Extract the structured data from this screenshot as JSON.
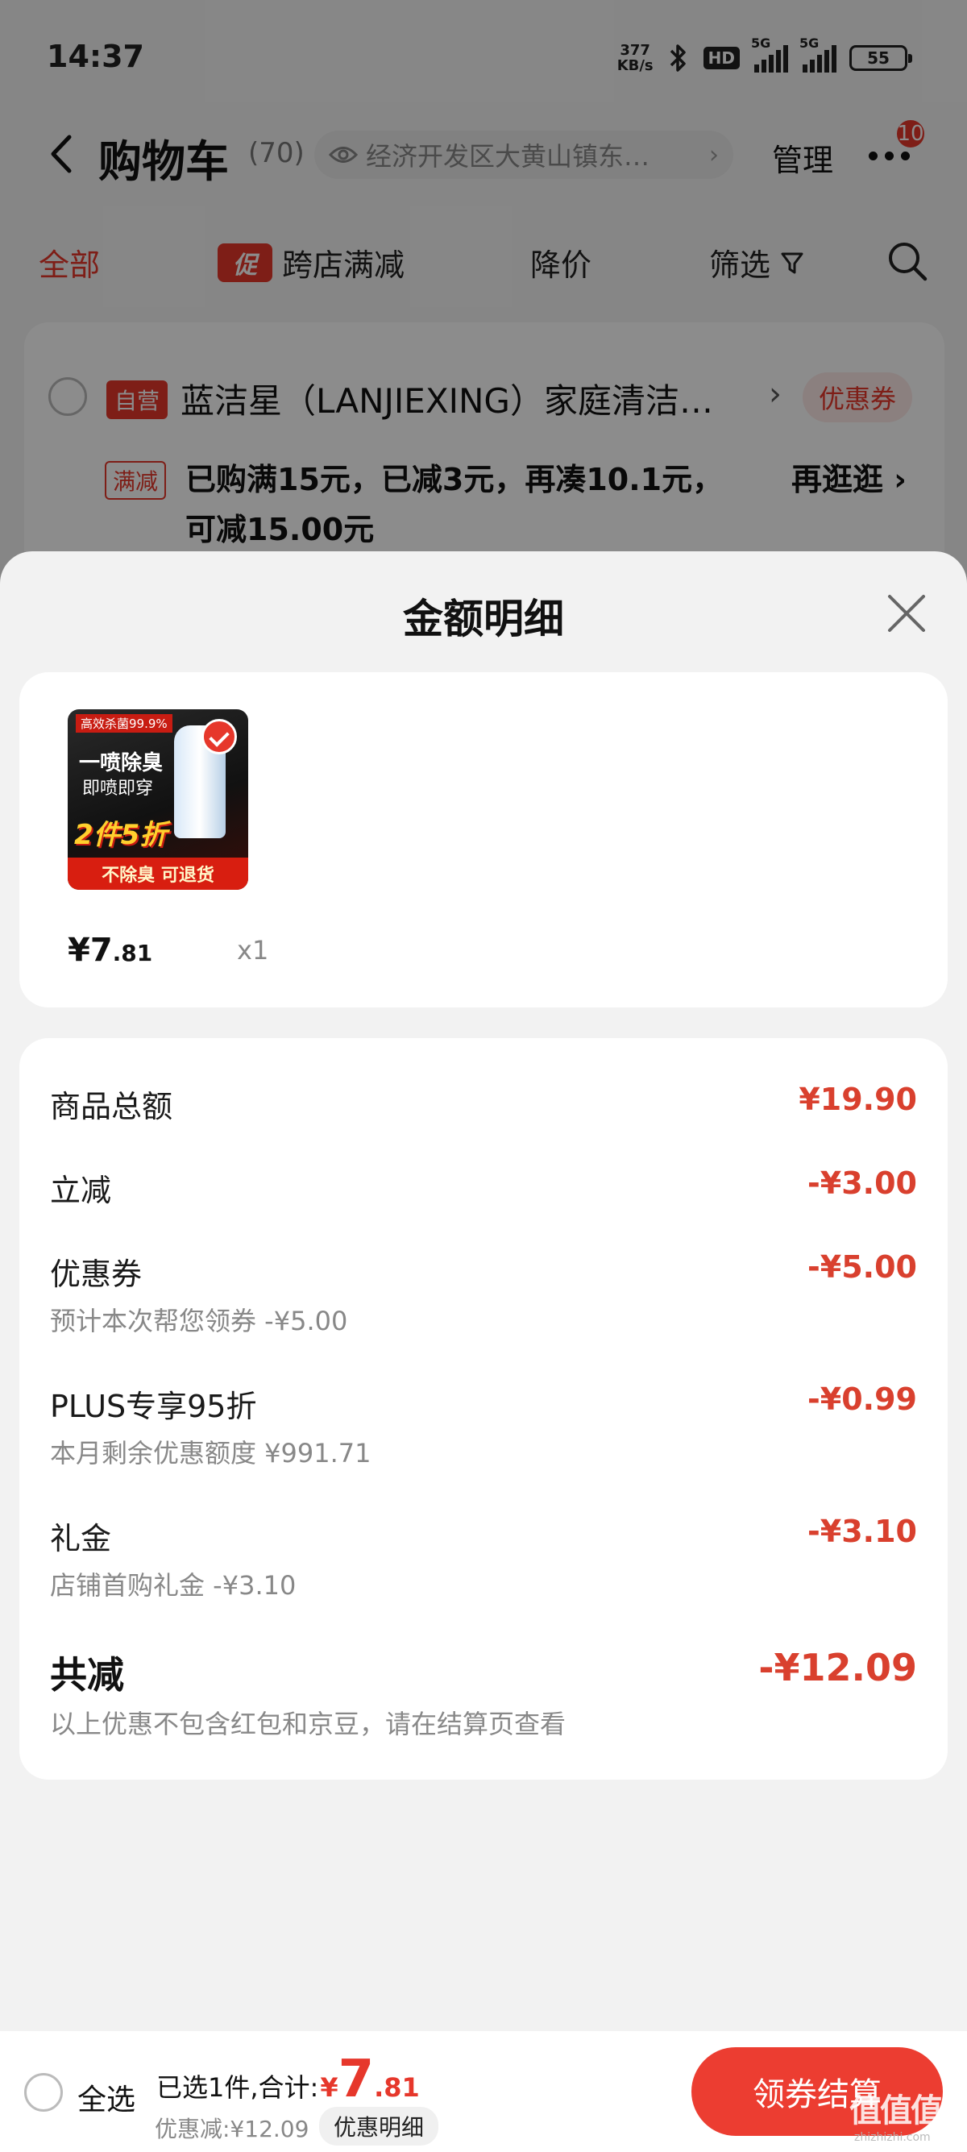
{
  "status_bar": {
    "time": "14:37",
    "net_speed_value": "377",
    "net_speed_unit": "KB/s",
    "hd_label": "HD",
    "sim1_label": "5G",
    "sim2_label": "5G",
    "battery": "55"
  },
  "nav": {
    "title": "购物车",
    "count": "(70)",
    "address": "经济开发区大黄山镇东…",
    "manage_label": "管理",
    "more_badge": "10"
  },
  "filters": {
    "all": "全部",
    "promo_tag": "促",
    "cross_store": "跨店满减",
    "price_drop": "降价",
    "filter": "筛选"
  },
  "store": {
    "self_tag": "自营",
    "name": "蓝洁星（LANJIEXING）家庭清洁…",
    "coupon_label": "优惠券",
    "manjian_tag": "满减",
    "manjian_text": "已购满15元，已减3元，再凑10.1元，可减15.00元",
    "go_shop": "再逛逛 ›"
  },
  "sheet": {
    "title": "金额明细",
    "product": {
      "image_text_1": "高效杀菌99.9%",
      "image_text_2": "一喷除臭",
      "image_text_3": "即喷即穿",
      "image_text_4": "2件5折",
      "image_text_5": "不除臭 可退货",
      "price_int": "¥7",
      "price_dec": ".81",
      "qty": "x1"
    },
    "rows": [
      {
        "label": "商品总额",
        "value": "¥19.90",
        "sub": ""
      },
      {
        "label": "立减",
        "value": "-¥3.00",
        "sub": ""
      },
      {
        "label": "优惠券",
        "value": "-¥5.00",
        "sub": "预计本次帮您领券 -¥5.00"
      },
      {
        "label": "PLUS专享95折",
        "value": "-¥0.99",
        "sub": "本月剩余优惠额度 ¥991.71"
      },
      {
        "label": "礼金",
        "value": "-¥3.10",
        "sub": "店铺首购礼金 -¥3.10"
      }
    ],
    "total": {
      "label": "共减",
      "value": "-¥12.09",
      "note": "以上优惠不包含红包和京豆，请在结算页查看"
    }
  },
  "bottom_bar": {
    "select_all": "全选",
    "selected_text": "已选1件,合计:",
    "currency": "¥",
    "total_int": "7",
    "total_dec": ".81",
    "saved_text": "优惠减:¥12.09",
    "detail_label": "优惠明细",
    "checkout_label": "领券结算",
    "watermark": "值值值",
    "watermark_sub": "zhizhizhi.com"
  },
  "colors": {
    "accent": "#e6372b",
    "price_red": "#d9402e",
    "background": "#f2f2f2"
  }
}
